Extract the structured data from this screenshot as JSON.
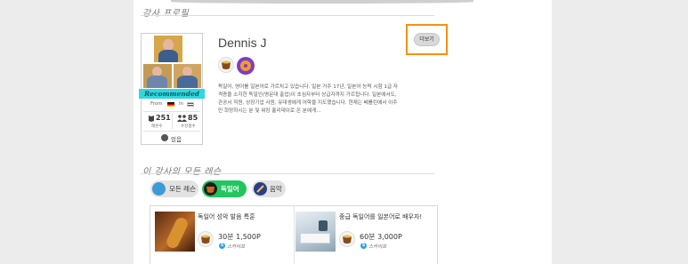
{
  "profile_section": {
    "title": "강사 프로필",
    "teacher_name": "Dennis J",
    "more_button": "더보기",
    "recommended": "Recommended",
    "from_label": "From",
    "in_label": "In",
    "lessons_count": "251",
    "lessons_label": "레슨수",
    "students_count": "85",
    "students_label": "수강생수",
    "availability": "있음",
    "bio_lines": [
      "독일어, 영어를 일본어로 가르치고 있습니다.  일본 거주 17년, 일본어 능력 시험 1급 자",
      "격증을 소지한 독일인(명문대 출업)이 초심자부터 상급자까지 가르칩니다. 일본에서도,",
      "관공서 직원, 상장기업 사원, 유대생에게 어학을 지도했습니다.  현재는 베를린에서 이주",
      "민 희망하시는 분 및 워킹 홀리데이로 온 분에게..."
    ]
  },
  "lessons_section": {
    "title": "이 강사의 모든 레슨",
    "tabs": [
      {
        "label": "모든 레슨",
        "active": false
      },
      {
        "label": "독일어",
        "active": true
      },
      {
        "label": "음악",
        "active": false
      }
    ],
    "lessons": [
      {
        "title": "독일어 성악 발음 특훈",
        "price": "30분 1,500P",
        "platform": "스카이프"
      },
      {
        "title": "중급 독일어를 일본어로 배우자!",
        "price": "60분 3,000P",
        "platform": "스카이프"
      }
    ]
  },
  "colors": {
    "accent_orange": "#f5920f",
    "ribbon_cyan": "#2ed8e0",
    "active_tab_green": "#22c55e"
  }
}
